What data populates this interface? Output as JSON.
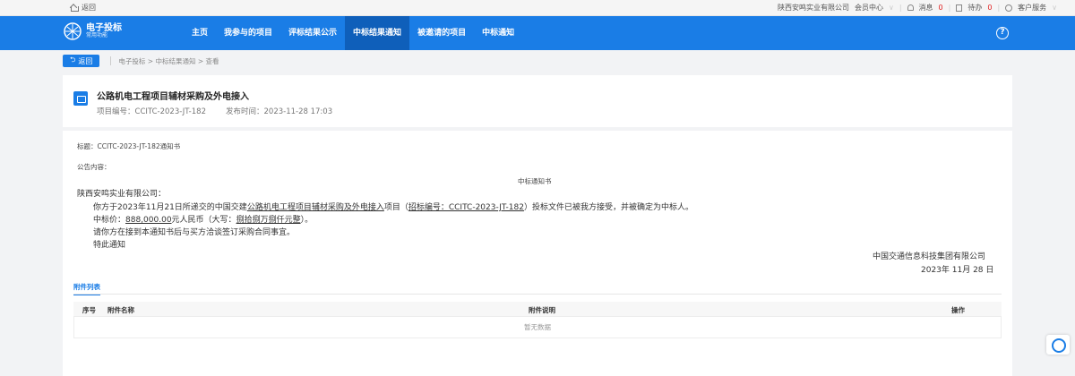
{
  "topbar": {
    "back_label": "返回",
    "company": "陕西安鸣实业有限公司",
    "member_center": "会员中心",
    "messages_label": "消息",
    "messages_count": "0",
    "todo_label": "待办",
    "todo_count": "0",
    "customer_service": "客户服务"
  },
  "nav": {
    "logo_title": "电子投标",
    "logo_sub": "常用功能",
    "items": [
      "主页",
      "我参与的项目",
      "评标结果公示",
      "中标结果通知",
      "被邀请的项目",
      "中标通知"
    ],
    "active_index": 3,
    "help_label": "?"
  },
  "breadcrumb": {
    "back_button": "返回",
    "path": "电子投标 > 中标结果通知 > 查看"
  },
  "header": {
    "title": "公路机电工程项目辅材采购及外电接入",
    "project_no_label": "项目编号：",
    "project_no": "CCITC-2023-JT-182",
    "publish_label": "发布时间：",
    "publish_time": "2023-11-28 17:03"
  },
  "notice": {
    "title_label": "标题：",
    "title_value": "CCITC-2023-JT-182通知书",
    "content_label": "公告内容：",
    "doc_heading": "中标通知书",
    "recipient": "陕西安鸣实业有限公司：",
    "para1_a": "你方于2023年11月21日所递交的中国交建",
    "para1_project": "公路机电工程项目辅材采购及外电接入",
    "para1_b": "项目（",
    "para1_bid_no": "招标编号：CCITC-2023-JT-182",
    "para1_c": "）投标文件已被我方接受，并被确定为中标人。",
    "price_label": "中标价：",
    "price_value": "888,000.00",
    "price_unit": "元人民币（大写：",
    "price_words": "捌拾捌万捌仟元整",
    "price_close": "）。",
    "para3": "请你方在接到本通知书后与买方洽谈签订采购合同事宜。",
    "para4": "特此通知",
    "signer": "中国交通信息科技集团有限公司",
    "sign_date": "2023年 11月 28 日"
  },
  "attachments": {
    "tab_label": "附件列表",
    "col_no": "序号",
    "col_name": "附件名称",
    "col_desc": "附件说明",
    "col_action": "操作",
    "empty_text": "暂无数据"
  },
  "colors": {
    "brand_blue": "#1a7de6",
    "nav_active": "#0f5fba",
    "badge_red": "#e02020"
  },
  "icons": [
    "home-icon",
    "bell-icon",
    "todo-icon",
    "service-icon",
    "help-icon",
    "folder-icon",
    "back-arrow-icon",
    "logo-icon",
    "customer-service-float-icon"
  ]
}
